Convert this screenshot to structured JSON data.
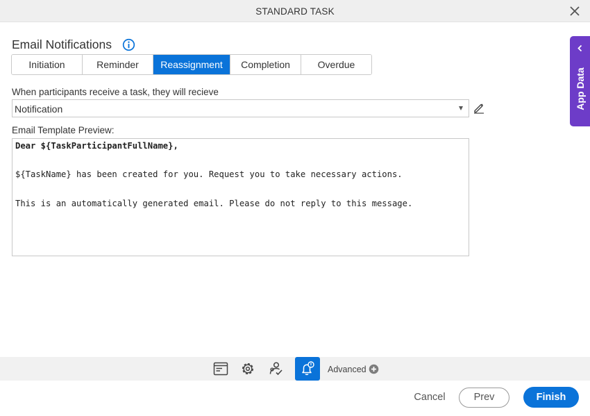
{
  "window": {
    "title": "STANDARD TASK",
    "close_icon": "close-icon"
  },
  "section": {
    "title": "Email Notifications",
    "info_icon": "info-icon"
  },
  "tabs": [
    {
      "label": "Initiation",
      "active": false
    },
    {
      "label": "Reminder",
      "active": false
    },
    {
      "label": "Reassignment",
      "active": true
    },
    {
      "label": "Completion",
      "active": false
    },
    {
      "label": "Overdue",
      "active": false
    }
  ],
  "receive": {
    "label": "When participants receive a task, they will recieve",
    "selected": "Notification",
    "edit_icon": "pencil-icon"
  },
  "preview": {
    "label": "Email Template Preview:",
    "lines": [
      "Dear ${TaskParticipantFullName},",
      "${TaskName} has been created for you. Request you to take necessary actions.",
      "This is an automatically generated email. Please do not reply to this message."
    ]
  },
  "side_panel": {
    "label": "App Data",
    "icon": "chevron-left-icon"
  },
  "toolbar": {
    "icons": [
      "form-icon",
      "gear-icon",
      "participants-icon",
      "notification-bell-icon"
    ],
    "active_icon": "notification-bell-icon",
    "advanced_label": "Advanced",
    "advanced_icon": "plus-circle-icon"
  },
  "footer": {
    "cancel": "Cancel",
    "prev": "Prev",
    "finish": "Finish"
  },
  "colors": {
    "accent": "#0a73d9",
    "side_panel": "#6d3cc8"
  }
}
